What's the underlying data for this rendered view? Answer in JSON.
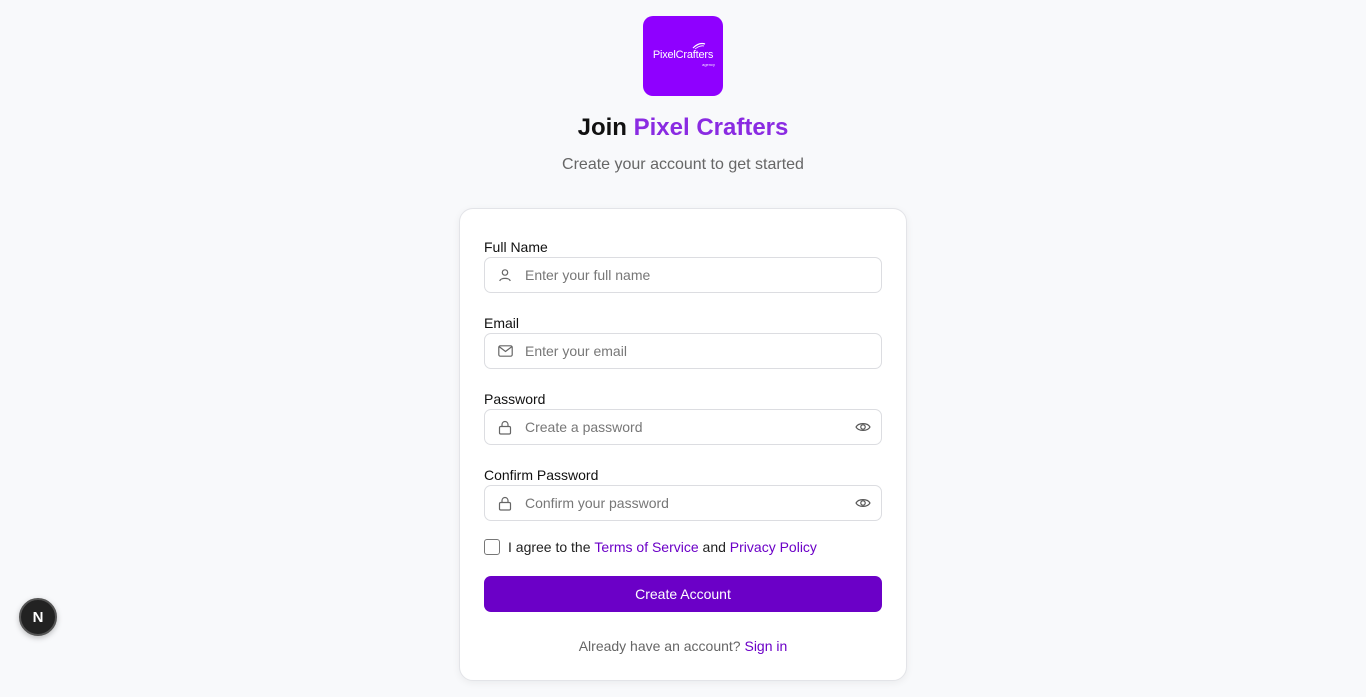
{
  "logo": {
    "wordmark": "PixelCrafters",
    "sub": "agency",
    "bg_color": "#8f00ff"
  },
  "header": {
    "title_prefix": "Join",
    "title_brand": "Pixel Crafters",
    "subtitle": "Create your account to get started"
  },
  "form": {
    "full_name": {
      "label": "Full Name",
      "placeholder": "Enter your full name",
      "icon": "user-icon"
    },
    "email": {
      "label": "Email",
      "placeholder": "Enter your email",
      "icon": "mail-icon"
    },
    "password": {
      "label": "Password",
      "placeholder": "Create a password",
      "icon": "lock-icon",
      "toggle_icon": "eye-icon"
    },
    "confirm_password": {
      "label": "Confirm Password",
      "placeholder": "Confirm your password",
      "icon": "lock-icon",
      "toggle_icon": "eye-icon"
    },
    "agree": {
      "prefix": "I agree to the",
      "terms_link": "Terms of Service",
      "conjunction": "and",
      "privacy_link": "Privacy Policy",
      "checked": false
    },
    "submit_label": "Create Account",
    "signin_prompt": "Already have an account?",
    "signin_link": "Sign in"
  },
  "dev_badge": {
    "letter": "N"
  },
  "colors": {
    "accent": "#6b00c7",
    "brand_text": "#8a2be2",
    "background": "#f8f9fb"
  }
}
